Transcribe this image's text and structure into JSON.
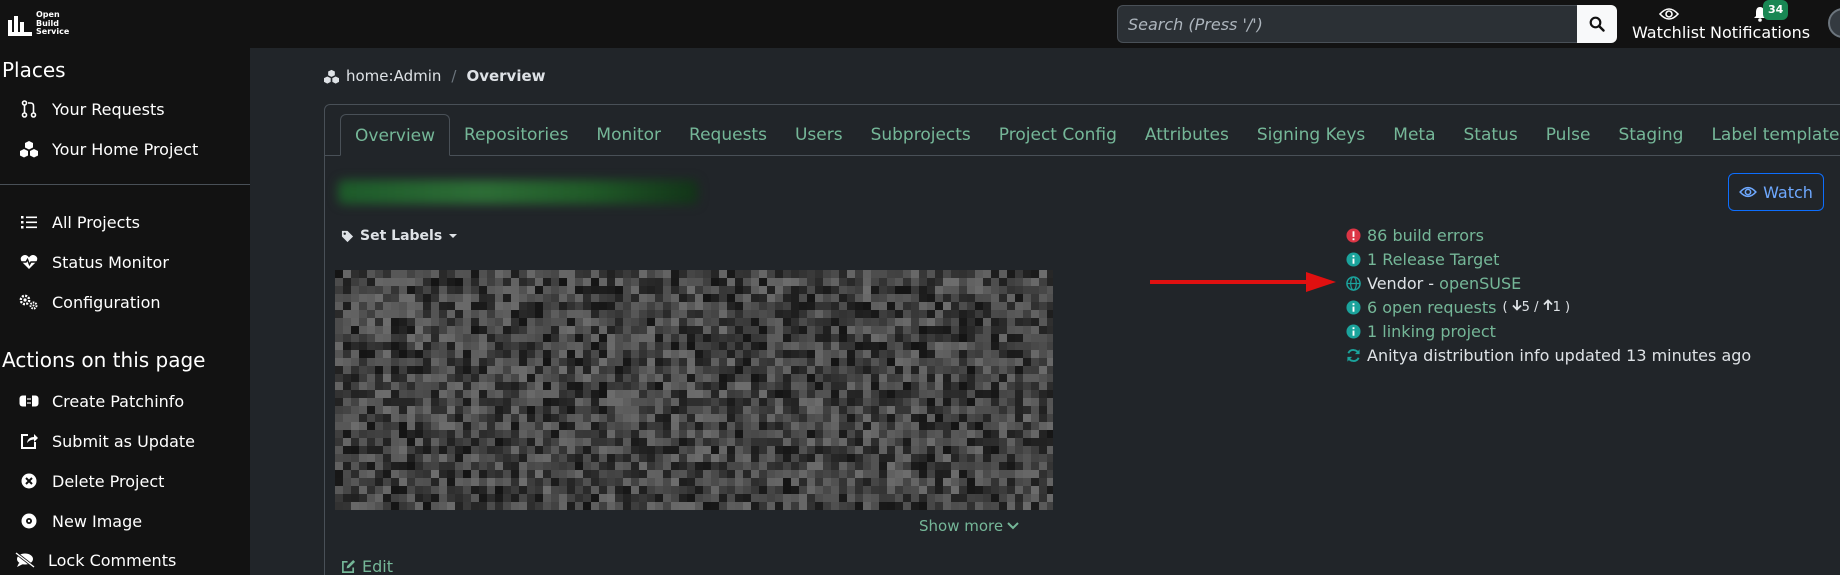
{
  "header": {
    "logo_line1": "Open",
    "logo_line2": "Build",
    "logo_line3": "Service",
    "search_placeholder": "Search (Press '/')",
    "watchlist_label": "Watchlist",
    "notifications_label": "Notifications",
    "notifications_count": "34"
  },
  "sidebar": {
    "places_heading": "Places",
    "places": [
      {
        "label": "Your Requests",
        "icon": "pull-request-icon"
      },
      {
        "label": "Your Home Project",
        "icon": "cubes-icon"
      }
    ],
    "global": [
      {
        "label": "All Projects",
        "icon": "list-icon"
      },
      {
        "label": "Status Monitor",
        "icon": "heartbeat-icon"
      },
      {
        "label": "Configuration",
        "icon": "cogs-icon"
      }
    ],
    "actions_heading": "Actions on this page",
    "actions": [
      {
        "label": "Create Patchinfo",
        "icon": "patch-icon"
      },
      {
        "label": "Submit as Update",
        "icon": "share-square-icon"
      },
      {
        "label": "Delete Project",
        "icon": "times-circle-icon"
      },
      {
        "label": "New Image",
        "icon": "compact-disc-icon"
      },
      {
        "label": "Lock Comments",
        "icon": "comment-slash-icon"
      }
    ]
  },
  "breadcrumb": {
    "project": "home:Admin",
    "separator": "/",
    "current": "Overview"
  },
  "tabs": [
    "Overview",
    "Repositories",
    "Monitor",
    "Requests",
    "Users",
    "Subprojects",
    "Project Config",
    "Attributes",
    "Signing Keys",
    "Meta",
    "Status",
    "Pulse",
    "Staging",
    "Label templates"
  ],
  "active_tab": "Overview",
  "watch_button": "Watch",
  "set_labels": "Set Labels",
  "show_more": "Show more",
  "edit": "Edit",
  "info": {
    "build_errors": "86 build errors",
    "release_target": "1 Release Target",
    "vendor_prefix": "Vendor - ",
    "vendor_name": "openSUSE",
    "open_requests": "6 open requests",
    "incoming": "5",
    "outgoing": "1",
    "req_separator": "/",
    "linking": "1 linking project",
    "anitya": "Anitya distribution info updated 13 minutes ago"
  },
  "colors": {
    "link": "#75b798",
    "error": "#dc3545",
    "info": "#20c997",
    "annotation_arrow": "#e01010"
  }
}
